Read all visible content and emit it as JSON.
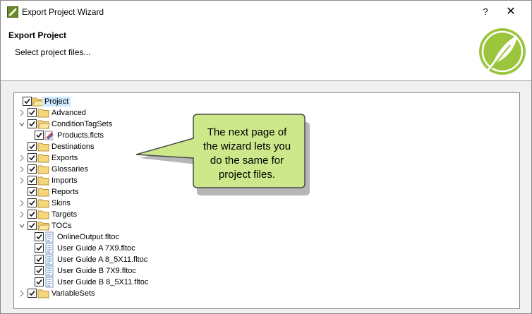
{
  "window": {
    "title": "Export Project Wizard",
    "help_label": "?",
    "close_label": "✕"
  },
  "header": {
    "title": "Export Project",
    "subtitle": "Select project files..."
  },
  "tree": {
    "root": "Project",
    "items": {
      "advanced": "Advanced",
      "conditiontagsets": "ConditionTagSets",
      "products": "Products.flcts",
      "destinations": "Destinations",
      "exports": "Exports",
      "glossaries": "Glossaries",
      "imports": "Imports",
      "reports": "Reports",
      "skins": "Skins",
      "targets": "Targets",
      "tocs": "TOCs",
      "onlineoutput": "OnlineOutput.fltoc",
      "guide_a_7x9": "User Guide A 7X9.fltoc",
      "guide_a_8x11": "User Guide A 8_5X11.fltoc",
      "guide_b_7x9": "User Guide B 7X9.fltoc",
      "guide_b_8x11": "User Guide B 8_5X11.fltoc",
      "variablesets": "VariableSets"
    }
  },
  "callout": {
    "line1": "The next page of",
    "line2": "the wizard lets you",
    "line3": "do the same for",
    "line4": "project files."
  },
  "colors": {
    "callout_fill": "#cce88a",
    "callout_border": "#4a4a4a",
    "logo_green": "#9bc53d",
    "folder_yellow": "#f6d67a",
    "selection": "#cce8ff"
  }
}
